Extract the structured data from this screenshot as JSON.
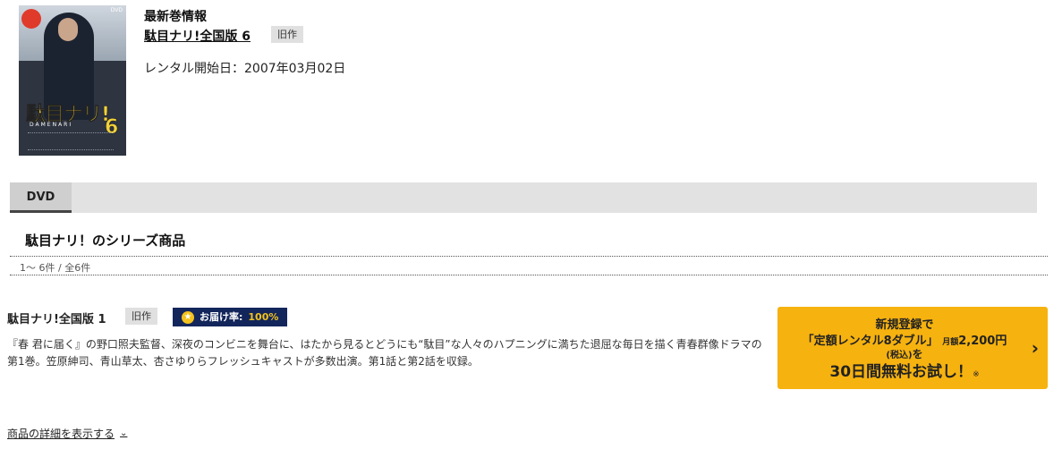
{
  "latest": {
    "section_label": "最新巻情報",
    "title": "駄目ナリ!全国版 6",
    "tag": "旧作",
    "rental_start": "レンタル開始日：2007年03月02日",
    "cover_logo": "駄目ナリ!",
    "cover_sub": "DAMENARI",
    "cover_volume": "6",
    "cover_mark": "DVD"
  },
  "tabs": [
    {
      "label": "DVD"
    }
  ],
  "series": {
    "heading": "駄目ナリ！のシリーズ商品",
    "count": "1～ 6件 / 全6件"
  },
  "item": {
    "title": "駄目ナリ!全国版 1",
    "tag": "旧作",
    "delivery_label": "お届け率:",
    "delivery_rate": "100%",
    "description": "『春 君に届く』の野口照夫監督、深夜のコンビニを舞台に、はたから見るとどうにも“駄目”な人々のハプニングに満ちた退屈な毎日を描く青春群像ドラマの第1巻。笠原紳司、青山草太、杏さゆりらフレッシュキャストが多数出演。第1話と第2話を収録。"
  },
  "cta": {
    "line1": "新規登録で",
    "line2_main": "「定額レンタル8ダブル」",
    "line2_small": "月額",
    "line2_price": "2,200円",
    "line3_small": "(税込)",
    "line3_wo": "を",
    "line4": "30日間無料お試し！",
    "line4_note": "※",
    "color": "#f6b20f"
  },
  "details_link": "商品の詳細を表示する",
  "colors": {
    "delivery_bg": "#13265b",
    "delivery_accent": "#f3c21c",
    "tag_bg": "#e0e0e0",
    "tab_bar": "#e2e2e2"
  }
}
